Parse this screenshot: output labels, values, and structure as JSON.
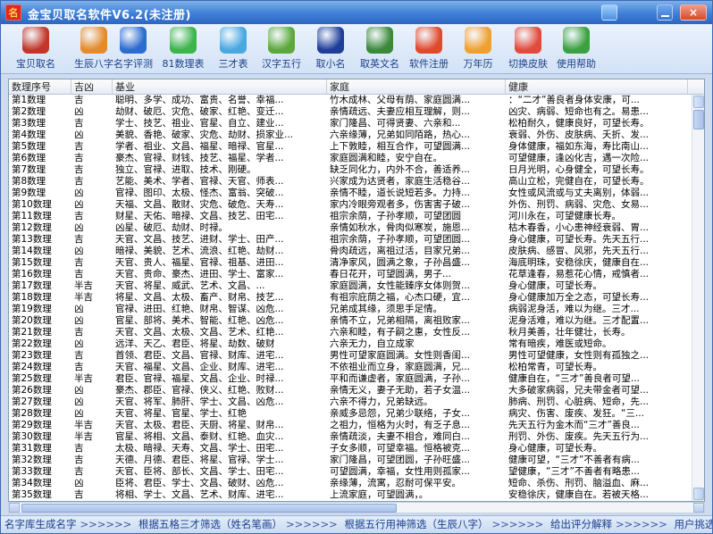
{
  "window": {
    "title": "金宝贝取名软件V6.2(未注册)",
    "app_icon": "名"
  },
  "toolbar": [
    {
      "label": "宝贝取名",
      "icon": "baby-icon",
      "color": "#c2362a"
    },
    {
      "label": "生辰八字",
      "icon": "magnifier-icon",
      "color": "#e48a2b"
    },
    {
      "label": "名字评测",
      "icon": "msn-icon",
      "color": "#2c6bd0"
    },
    {
      "label": "81数理表",
      "icon": "chat-bubble-icon",
      "color": "#3cb54a"
    },
    {
      "label": "三才表",
      "icon": "twitter-icon",
      "color": "#48a8e0"
    },
    {
      "label": "汉字五行",
      "icon": "people-icon",
      "color": "#5ca83c"
    },
    {
      "label": "取小名",
      "icon": "car-icon",
      "color": "#1e3e9a"
    },
    {
      "label": "取英文名",
      "icon": "stumbleupon-icon",
      "color": "#3b8a3a"
    },
    {
      "label": "软件注册",
      "icon": "reddit-icon",
      "color": "#e04a2c"
    },
    {
      "label": "万年历",
      "icon": "calendar-dots-icon",
      "color": "#f0a030"
    },
    {
      "label": "切换皮肤",
      "icon": "heart-icon",
      "color": "#e24a3c"
    },
    {
      "label": "使用帮助",
      "icon": "help-icon",
      "color": "#3aa040"
    }
  ],
  "grid": {
    "columns": [
      "数理序号",
      "吉凶",
      "基业",
      "家庭",
      "健康"
    ],
    "rows": [
      [
        "第1数理",
        "吉",
        "聪明、多学、成功、富贵、名誉、幸福...",
        "竹木成林、父母有荫、家庭圆满...",
        "：“二才”善良者身体安康，可..."
      ],
      [
        "第2数理",
        "凶",
        "劫财、破厄、灾危、破家、红艳、变迁...",
        "亲情疏远、夫妻应相互理解，则...",
        "凶灾、病弱、短命也有之。易患..."
      ],
      [
        "第3数理",
        "吉",
        "学士、技艺、祖业、官星、自立、建业...",
        "家门隆昌、可得贤妻、六亲和...",
        "松柏耐久，健康良好，可望长寿。"
      ],
      [
        "第4数理",
        "凶",
        "美貌、香艳、破家、灾危、劫财、损家业...",
        "六亲缘薄，兄弟如同陌路，热心...",
        "衰弱、外伤、皮肤病、夭折、发..."
      ],
      [
        "第5数理",
        "吉",
        "学者、祖业、文昌、福星、暗禄、官星...",
        "上下敦睦，相互合作，可望圆满...",
        "身体健康，福如东海，寿比南山..."
      ],
      [
        "第6数理",
        "吉",
        "豪杰、官禄、财钱、技艺、福星、学者...",
        "家庭圆满和睦，安宁自在。",
        "可望健康，逢凶化吉，遇一次险..."
      ],
      [
        "第7数理",
        "吉",
        "独立、官禄、进取、技术、刚硬。",
        "缺乏同化力，内外不合，善适养...",
        "日月光明，心身健全，可望长寿。"
      ],
      [
        "第8数理",
        "吉",
        "艺能、美术、学者、官禄、天官、师表...",
        "兴家成为达贤者，家庭生活稳谷...",
        "高山立松，完健自在，可望长寿。"
      ],
      [
        "第9数理",
        "凶",
        "官禄、图印、太极、怪杰、富翁、突破...",
        "亲情不睦，道长说短若多。力持...",
        "女性或风流或与丈夫离别，体弱..."
      ],
      [
        "第10数理",
        "凶",
        "天福、文昌、散财、灾危、破危、天寿...",
        "家内冷眼旁观者多，伤害害子破...",
        "外伤、刑罚、病弱、灾危、女易..."
      ],
      [
        "第11数理",
        "吉",
        "财星、天佑、暗禄、文昌、技艺、田宅...",
        "祖宗余荫，子孙孝顺，可望团圆",
        "河川永在，可望健康长寿。"
      ],
      [
        "第12数理",
        "凶",
        "凶星、破厄、劫财、时禄。",
        "亲情如秋水，骨肉似寒炭，施恩...",
        "枯木春香，小心患神经衰弱、胃..."
      ],
      [
        "第13数理",
        "吉",
        "天官、文昌、技艺、进财、学士、田产...",
        "祖宗余荫，子孙孝顺，可望团圆...",
        "身心健康，可望长寿。先天五行..."
      ],
      [
        "第14数理",
        "凶",
        "暗禄、美貌、艺术、流浪、红艳、劫财...",
        "骨肉疏远，离祖过活，目家兄弟...",
        "皮肤病、感冒、风邪，先天五行..."
      ],
      [
        "第15数理",
        "吉",
        "天官、贵人、福星、官禄、祖基、进田...",
        "清净家风，圆满之象，子孙昌盛...",
        "海底明珠，安稳徐庆，健康自在..."
      ],
      [
        "第16数理",
        "吉",
        "天官、贵命、豪杰、进田、学士、富家...",
        "春日花开，可望圆满，男子...",
        "花草逢春，易惹花心情，戒慎者..."
      ],
      [
        "第17数理",
        "半吉",
        "天官、将星、威武、艺术、文昌、...",
        "家庭圆满，女性能臻序女体则贺...",
        "身心健康，可望长寿。"
      ],
      [
        "第18数理",
        "半吉",
        "将星、文昌、太极、畜产、财帛、技艺...",
        "有祖宗庇荫之福，心杰口硬，宜...",
        "身心健康加万全之态，可望长寿..."
      ],
      [
        "第19数理",
        "凶",
        "官禄、进田、红艳、财帛、智谋、凶危...",
        "兄弟成其缘，须思手足情。",
        "病弱泥身活，难以为继。三才..."
      ],
      [
        "第20数理",
        "凶",
        "官星、部将、美术、智能、红艳、凶危...",
        "亲情不立，兄弟相隔，离祖败家...",
        "泥身活难，难以为继。三才配置..."
      ],
      [
        "第21数理",
        "吉",
        "天官、文昌、太极、文昌、艺术、红艳...",
        "六亲和睦，有子嗣之惠，女性反...",
        "秋月美善，壮年健壮，长寿。"
      ],
      [
        "第22数理",
        "凶",
        "远洋、天乙、君臣、将星、劫数、破财",
        "六亲无力，自立成家",
        "常有暗疾，难医或短命。"
      ],
      [
        "第23数理",
        "吉",
        "首领、君臣、文昌、官禄、财库、进宅...",
        "男性可望家庭圆满。女性则香闺...",
        "男性可望健康，女性则有孤独之..."
      ],
      [
        "第24数理",
        "吉",
        "天官、福星、文昌、企业、财库、进宅...",
        "不依祖业而立身，家庭圆满，兄...",
        "松柏常青，可望长寿。"
      ],
      [
        "第25数理",
        "半吉",
        "君臣、官禄、福星、文昌、企业、时禄...",
        "平和而谦虚者，家庭圆满，子孙...",
        "健康自在，“三才”善良者可望..."
      ],
      [
        "第26数理",
        "凶",
        "豪杰、郡臣、官禄、侠义、红艳、败财...",
        "亲情无义，妻子无助，若子女温...",
        "大多破家病弱，兄夫带金者可望..."
      ],
      [
        "第27数理",
        "凶",
        "天官、将军、肺肝、学士、文昌、凶危...",
        "六亲不得力，兄弟缺远。",
        "肺病、刑罚、心脏病、短命，先..."
      ],
      [
        "第28数理",
        "凶",
        "天官、将星、官星、学士、红艳",
        "亲威多忌怨，兄弟少联络，子女...",
        "病灾、伤害、废疾、发狂。“三..."
      ],
      [
        "第29数理",
        "半吉",
        "天官、太极、君臣、天厨、将星、财帛...",
        "之祖力，恒格为火时，有乏子息...",
        "先天五行为金木而“三才”善良..."
      ],
      [
        "第30数理",
        "半吉",
        "官星、将相、文昌、泰财、红艳、血灾...",
        "亲情疏淡，夫妻不相合，难同白...",
        "刑罚、外伤、废疾。先天五行为..."
      ],
      [
        "第31数理",
        "吉",
        "太极、暗禄、天寿、文昌、学士、田宅...",
        "子女多顺，可望幸福。恒格被克...",
        "身心健康，可望长寿。"
      ],
      [
        "第32数理",
        "吉",
        "天德、月德、君臣、将星、官禄、学士...",
        "家门隆昌，可望团圆，子孙旺盛...",
        "健康可望，“三才”不善者有病..."
      ],
      [
        "第33数理",
        "吉",
        "天官、臣将、部长、文昌、学士、田宅...",
        "可望圆满，幸福，女性用则孤家...",
        "望健康，“三才”不善者有略患..."
      ],
      [
        "第34数理",
        "凶",
        "臣将、君臣、学士、文昌、破财、凶危...",
        "亲缘薄，流寓，忍耐可保平安。",
        "短命、杀伤、刑罚、脑溢血、麻..."
      ],
      [
        "第35数理",
        "吉",
        "将相、学士、文昌、艺术、财库、进宅...",
        "上流家庭，可望圆满，。",
        "安稳徐庆，健康自在。若被天格..."
      ]
    ]
  },
  "statusbar": {
    "step1": "名字库生成名字",
    "arrow": ">>>>>>",
    "step2": "根据五格三才筛选（姓名笔画）",
    "step3": "根据五行用神筛选（生辰八字）",
    "step4": "给出评分解释",
    "step5": "用户挑选"
  }
}
